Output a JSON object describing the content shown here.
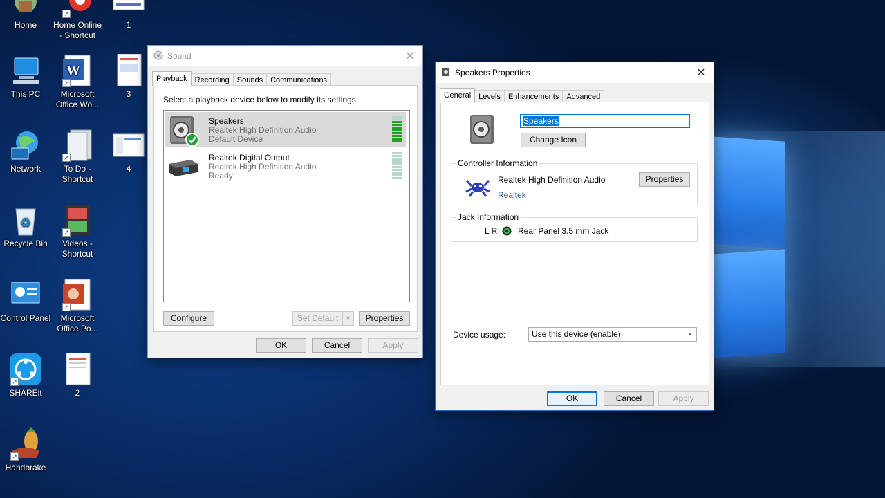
{
  "desktop": {
    "icons": [
      {
        "label": "Home",
        "icon": "home-icon"
      },
      {
        "label": "Home Online - Shortcut",
        "icon": "browser-icon"
      },
      {
        "label": "1",
        "icon": "image-file-icon"
      },
      {
        "label": "This PC",
        "icon": "computer-icon"
      },
      {
        "label": "Microsoft Office Wo...",
        "icon": "word-icon"
      },
      {
        "label": "3",
        "icon": "image-file-icon"
      },
      {
        "label": "Network",
        "icon": "network-icon"
      },
      {
        "label": "To Do - Shortcut",
        "icon": "folder-icon"
      },
      {
        "label": "4",
        "icon": "image-file-icon"
      },
      {
        "label": "Recycle Bin",
        "icon": "recycle-bin-icon"
      },
      {
        "label": "Videos - Shortcut",
        "icon": "videos-icon"
      },
      {
        "label": "Control Panel",
        "icon": "control-panel-icon"
      },
      {
        "label": "Microsoft Office Po...",
        "icon": "powerpoint-icon"
      },
      {
        "label": "SHAREit",
        "icon": "shareit-icon"
      },
      {
        "label": "2",
        "icon": "document-icon"
      },
      {
        "label": "Handbrake",
        "icon": "handbrake-icon"
      }
    ]
  },
  "sound": {
    "title": "Sound",
    "tabs": [
      "Playback",
      "Recording",
      "Sounds",
      "Communications"
    ],
    "instruction": "Select a playback device below to modify its settings:",
    "devices": [
      {
        "name": "Speakers",
        "driver": "Realtek High Definition Audio",
        "status": "Default Device",
        "level": 0.8
      },
      {
        "name": "Realtek Digital Output",
        "driver": "Realtek High Definition Audio",
        "status": "Ready",
        "level": 0
      }
    ],
    "buttons": {
      "configure": "Configure",
      "set_default": "Set Default",
      "properties": "Properties",
      "ok": "OK",
      "cancel": "Cancel",
      "apply": "Apply"
    }
  },
  "speakers": {
    "title": "Speakers Properties",
    "tabs": [
      "General",
      "Levels",
      "Enhancements",
      "Advanced"
    ],
    "name_value": "Speakers",
    "change_icon": "Change Icon",
    "controller": {
      "legend": "Controller Information",
      "name": "Realtek High Definition Audio",
      "vendor": "Realtek",
      "properties": "Properties"
    },
    "jack": {
      "legend": "Jack Information",
      "channels": "L R",
      "name": "Rear Panel 3.5 mm Jack"
    },
    "device_usage_label": "Device usage:",
    "device_usage_value": "Use this device (enable)",
    "buttons": {
      "ok": "OK",
      "cancel": "Cancel",
      "apply": "Apply"
    }
  },
  "colors": {
    "accent": "#0078d7",
    "level_on": "#1fa31f",
    "level_off": "#b8d6c8",
    "link": "#1f5fa8"
  }
}
